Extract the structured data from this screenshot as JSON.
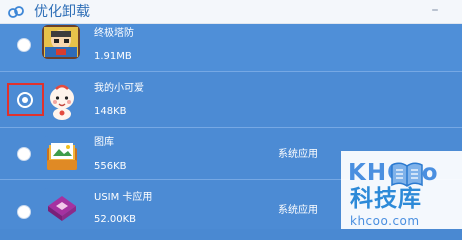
{
  "window": {
    "title": "优化卸载",
    "minimize_label": "–"
  },
  "apps": [
    {
      "name": "终极塔防",
      "size": "1.91MB",
      "tag": "",
      "selected": false
    },
    {
      "name": "我的小可爱",
      "size": "148KB",
      "tag": "",
      "selected": true
    },
    {
      "name": "图库",
      "size": "556KB",
      "tag": "系统应用",
      "selected": false
    },
    {
      "name": "USIM 卡应用",
      "size": "52.00KB",
      "tag": "系统应用",
      "selected": false
    }
  ],
  "watermark": {
    "logo": "KHCoo",
    "title": "科技库",
    "url": "khcoo.com"
  },
  "colors": {
    "list_bg": "#4a89d2",
    "highlight": "#e0312c"
  }
}
